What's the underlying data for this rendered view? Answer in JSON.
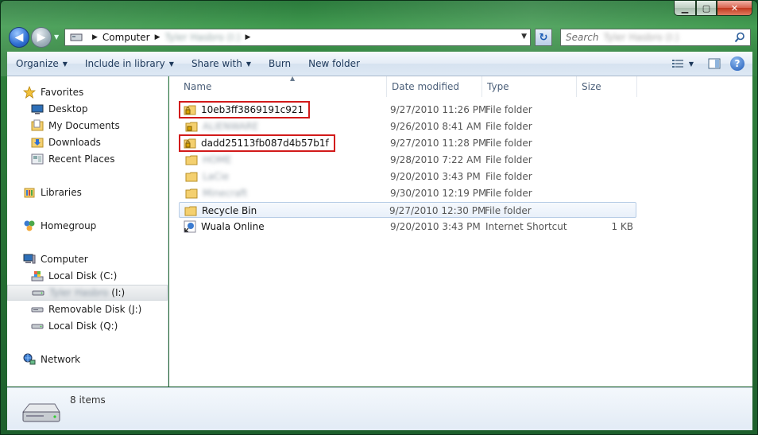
{
  "window": {
    "caption": {
      "minimize": "▁",
      "maximize": "▢",
      "close": "✕"
    }
  },
  "address": {
    "crumbs": [
      "Computer",
      "Tyler Hasbro (I:)"
    ]
  },
  "search": {
    "placeholder": "Search",
    "scope": "Tyler Hasbro (I:)"
  },
  "commands": {
    "organize": "Organize",
    "include_in_library": "Include in library",
    "share_with": "Share with",
    "burn": "Burn",
    "new_folder": "New folder"
  },
  "nav": {
    "favorites": "Favorites",
    "desktop": "Desktop",
    "my_documents": "My Documents",
    "downloads": "Downloads",
    "recent_places": "Recent Places",
    "libraries": "Libraries",
    "homegroup": "Homegroup",
    "computer": "Computer",
    "local_c": "Local Disk (C:)",
    "drive_i_label": "Tyler Hasbro",
    "drive_i_letter": "(I:)",
    "removable_j": "Removable Disk (J:)",
    "local_q": "Local Disk (Q:)",
    "network": "Network"
  },
  "columns": {
    "name": "Name",
    "date": "Date modified",
    "type": "Type",
    "size": "Size"
  },
  "files": [
    {
      "name": "10eb3ff3869191c921",
      "date": "9/27/2010 11:26 PM",
      "type": "File folder",
      "size": ""
    },
    {
      "name": "ALIENWARE",
      "date": "9/26/2010 8:41 AM",
      "type": "File folder",
      "size": ""
    },
    {
      "name": "dadd25113fb087d4b57b1f",
      "date": "9/27/2010 11:28 PM",
      "type": "File folder",
      "size": ""
    },
    {
      "name": "HOME",
      "date": "9/28/2010 7:22 AM",
      "type": "File folder",
      "size": ""
    },
    {
      "name": "LaCie",
      "date": "9/20/2010 3:43 PM",
      "type": "File folder",
      "size": ""
    },
    {
      "name": "Minecraft",
      "date": "9/30/2010 12:19 PM",
      "type": "File folder",
      "size": ""
    },
    {
      "name": "Recycle Bin",
      "date": "9/27/2010 12:30 PM",
      "type": "File folder",
      "size": ""
    },
    {
      "name": "Wuala Online",
      "date": "9/20/2010 3:43 PM",
      "type": "Internet Shortcut",
      "size": "1 KB"
    }
  ],
  "details": {
    "count": "8 items"
  },
  "colors": {
    "highlight_box": "#d21a1a",
    "glass": "#2b7a3c"
  }
}
